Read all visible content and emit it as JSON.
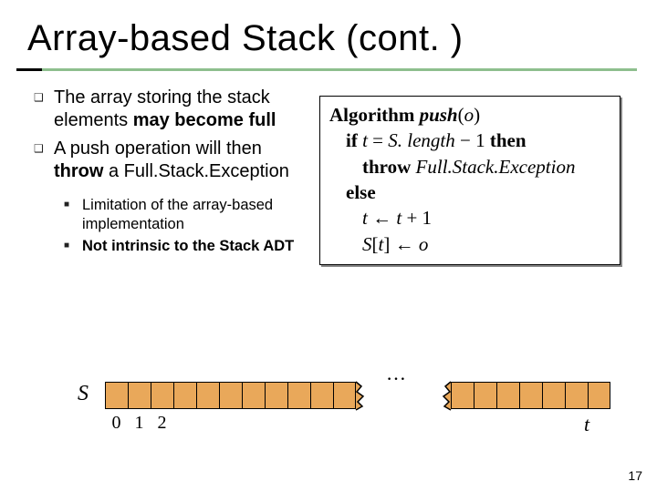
{
  "title": "Array-based Stack (cont. )",
  "bullets": [
    {
      "pre": "The array storing the stack elements ",
      "bold1": "may become full",
      "post": ""
    },
    {
      "pre": "A push operation will then ",
      "bold1": "throw",
      "post": " a Full.Stack.Exception"
    }
  ],
  "subbullets": [
    "Limitation of the array-based  implementation",
    "Not intrinsic to the Stack ADT"
  ],
  "algo": {
    "line1a": "Algorithm",
    "line1b": "push",
    "line1c": "(",
    "line1d": "o",
    "line1e": ")",
    "line2a": "if",
    "line2b": "t",
    "line2c": " = ",
    "line2d": "S. length",
    "line2e": " − 1 ",
    "line2f": "then",
    "line3a": "throw",
    "line3b": "Full.Stack.Exception",
    "line4a": "else",
    "line5a": "t",
    "line5b": " ← ",
    "line5c": "t",
    "line5d": " + 1",
    "line6a": "S",
    "line6b": "[",
    "line6c": "t",
    "line6d": "] ← ",
    "line6e": "o"
  },
  "diagram": {
    "s_label": "S",
    "indices": [
      "0",
      "1",
      "2"
    ],
    "dots": "…",
    "t_label": "t"
  },
  "page_number": "17"
}
